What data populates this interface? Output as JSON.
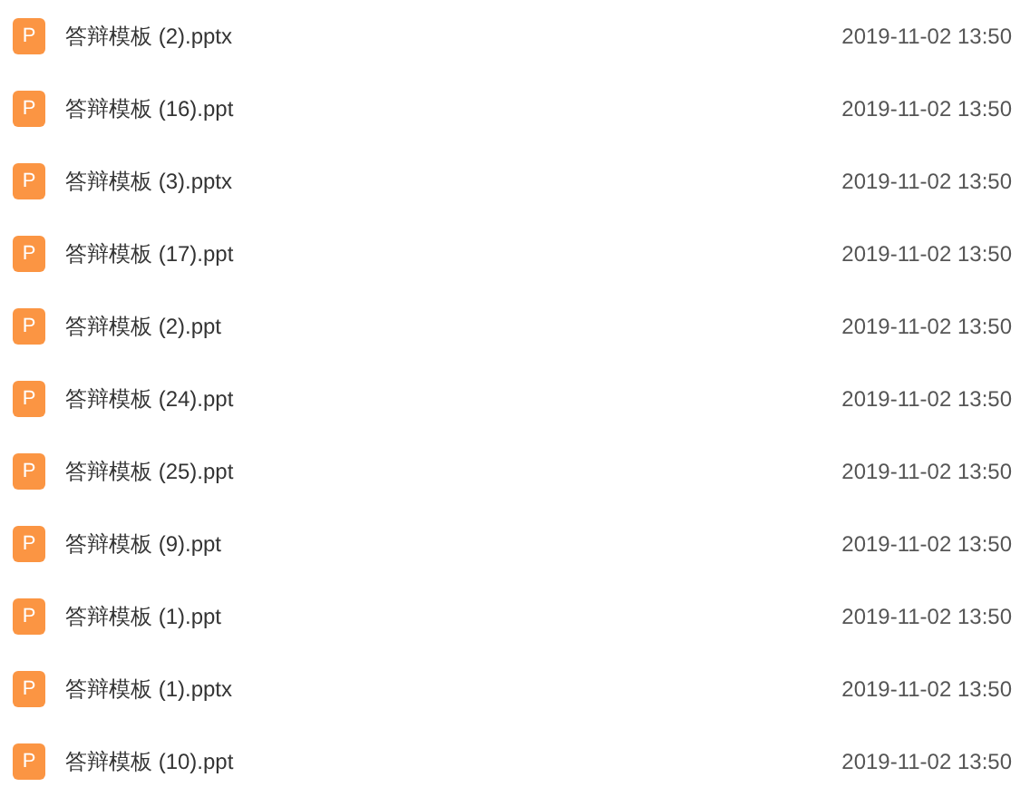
{
  "files": [
    {
      "icon_letter": "P",
      "name": "答辩模板 (2).pptx",
      "modified": "2019-11-02 13:50"
    },
    {
      "icon_letter": "P",
      "name": "答辩模板 (16).ppt",
      "modified": "2019-11-02 13:50"
    },
    {
      "icon_letter": "P",
      "name": "答辩模板 (3).pptx",
      "modified": "2019-11-02 13:50"
    },
    {
      "icon_letter": "P",
      "name": "答辩模板 (17).ppt",
      "modified": "2019-11-02 13:50"
    },
    {
      "icon_letter": "P",
      "name": "答辩模板 (2).ppt",
      "modified": "2019-11-02 13:50"
    },
    {
      "icon_letter": "P",
      "name": "答辩模板 (24).ppt",
      "modified": "2019-11-02 13:50"
    },
    {
      "icon_letter": "P",
      "name": "答辩模板 (25).ppt",
      "modified": "2019-11-02 13:50"
    },
    {
      "icon_letter": "P",
      "name": "答辩模板 (9).ppt",
      "modified": "2019-11-02 13:50"
    },
    {
      "icon_letter": "P",
      "name": "答辩模板 (1).ppt",
      "modified": "2019-11-02 13:50"
    },
    {
      "icon_letter": "P",
      "name": "答辩模板 (1).pptx",
      "modified": "2019-11-02 13:50"
    },
    {
      "icon_letter": "P",
      "name": "答辩模板 (10).ppt",
      "modified": "2019-11-02 13:50"
    }
  ]
}
